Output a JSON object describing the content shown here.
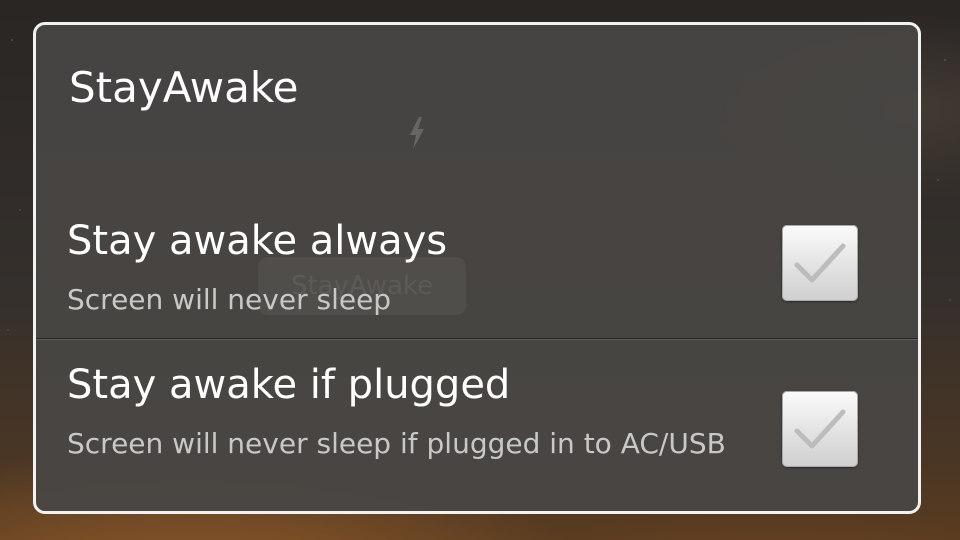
{
  "dialog": {
    "title": "StayAwake"
  },
  "background_app": {
    "button_label": "StayAwake",
    "icon": "lightning-bolt-icon"
  },
  "preferences": [
    {
      "title": "Stay awake always",
      "summary": "Screen will never sleep",
      "checked": false,
      "icon": "checkmark-icon"
    },
    {
      "title": "Stay awake if plugged",
      "summary": "Screen will never sleep if plugged in to AC/USB",
      "checked": false,
      "icon": "checkmark-icon"
    }
  ],
  "colors": {
    "dialog_border": "#f2f2f2",
    "dialog_background": "#484644",
    "title_text": "#ffffff",
    "summary_text": "#c8c8c8",
    "checkmark_unchecked": "#bcbcbc"
  }
}
